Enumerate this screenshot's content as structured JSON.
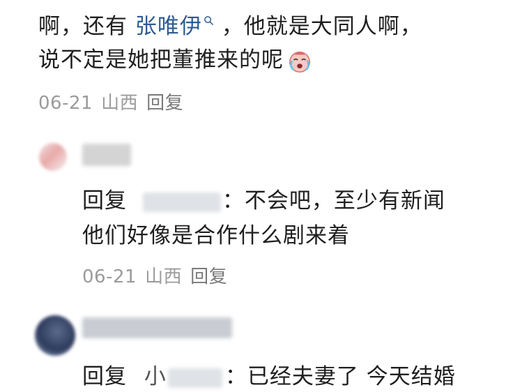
{
  "comment": {
    "text_before": "啊，还有 ",
    "mention": "张唯伊",
    "text_after_line1": " ，他就是大同人啊，",
    "line2": "说不定是她把董推来的呢",
    "date": "06-21",
    "location": "山西",
    "reply_label": "回复"
  },
  "replies": [
    {
      "prefix": "回复",
      "text_line1": "：不会吧，至少有新闻",
      "text_line2": "他们好像是合作什么剧来着",
      "date": "06-21",
      "location": "山西",
      "reply_label": "回复"
    },
    {
      "prefix": "回复",
      "target_visible": "小",
      "text_line1": "：已经夫妻了 今天结婚"
    }
  ],
  "colors": {
    "link": "#2f5c93",
    "meta": "#9b9b9b",
    "text": "#1f1f1f"
  },
  "icons": [
    "search-icon",
    "crying-emoji-icon",
    "avatar"
  ]
}
